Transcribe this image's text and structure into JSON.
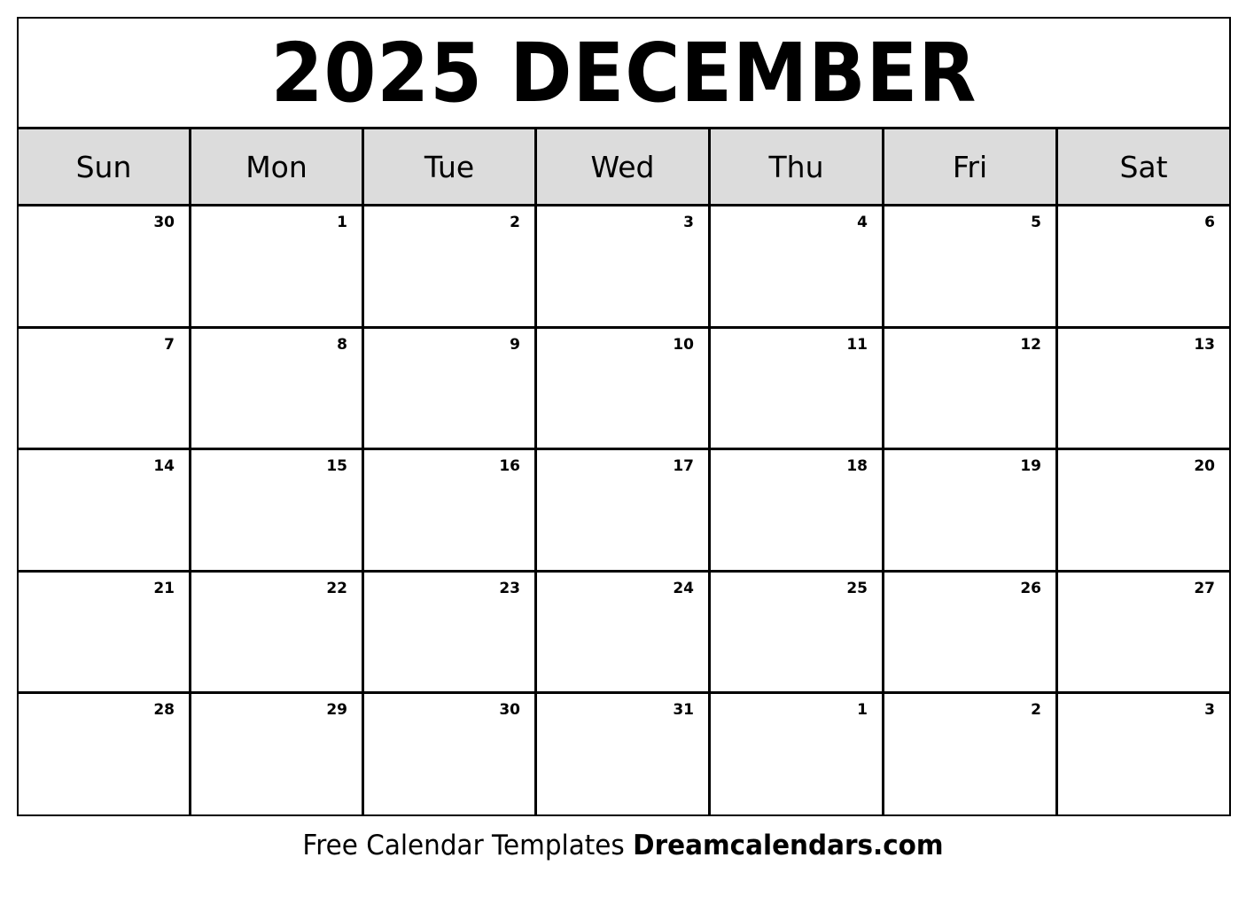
{
  "title": "2025 DECEMBER",
  "colors": {
    "header_bg": "#dcdcdc",
    "border": "#000000",
    "background": "#ffffff"
  },
  "weekdays": [
    "Sun",
    "Mon",
    "Tue",
    "Wed",
    "Thu",
    "Fri",
    "Sat"
  ],
  "weeks": [
    [
      "30",
      "1",
      "2",
      "3",
      "4",
      "5",
      "6"
    ],
    [
      "7",
      "8",
      "9",
      "10",
      "11",
      "12",
      "13"
    ],
    [
      "14",
      "15",
      "16",
      "17",
      "18",
      "19",
      "20"
    ],
    [
      "21",
      "22",
      "23",
      "24",
      "25",
      "26",
      "27"
    ],
    [
      "28",
      "29",
      "30",
      "31",
      "1",
      "2",
      "3"
    ]
  ],
  "footer": {
    "text": "Free Calendar Templates",
    "brand": "Dreamcalendars.com"
  }
}
